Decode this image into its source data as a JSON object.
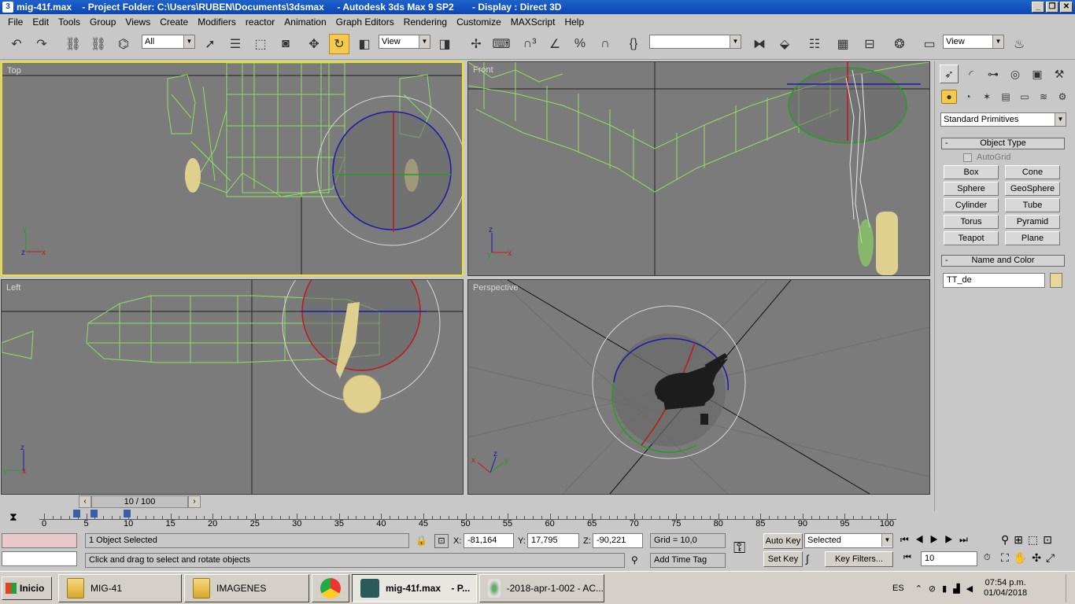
{
  "window": {
    "title": "mig-41f.max    - Project Folder: C:\\Users\\RUBEN\\Documents\\3dsmax     - Autodesk 3ds Max 9 SP2       - Display : Direct 3D",
    "app_icon": "3ds-max-icon",
    "buttons": [
      "_",
      "❐",
      "✕"
    ]
  },
  "menu": [
    "File",
    "Edit",
    "Tools",
    "Group",
    "Views",
    "Create",
    "Modifiers",
    "reactor",
    "Animation",
    "Graph Editors",
    "Rendering",
    "Customize",
    "MAXScript",
    "Help"
  ],
  "toolbar": {
    "selection_filter": "All",
    "ref_coord": "View",
    "named_selection": "",
    "render_view": "View"
  },
  "viewports": {
    "top": "Top",
    "front": "Front",
    "left": "Left",
    "perspective": "Perspective"
  },
  "axis": {
    "x": "x",
    "y": "y",
    "z": "z"
  },
  "command_panel": {
    "category": "Standard Primitives",
    "object_type_title": "Object Type",
    "autogrid": "AutoGrid",
    "buttons": [
      "Box",
      "Cone",
      "Sphere",
      "GeoSphere",
      "Cylinder",
      "Tube",
      "Torus",
      "Pyramid",
      "Teapot",
      "Plane"
    ],
    "name_color_title": "Name and Color",
    "object_name": "TT_de",
    "object_color": "#e8d898"
  },
  "time": {
    "frame": "10 / 100",
    "ticks": [
      "0",
      "5",
      "10",
      "15",
      "20",
      "25",
      "30",
      "35",
      "40",
      "45",
      "50",
      "55",
      "60",
      "65",
      "70",
      "75",
      "80",
      "85",
      "90",
      "95",
      "100"
    ]
  },
  "status": {
    "selected": "1 Object Selected",
    "prompt": "Click and drag to select and rotate objects",
    "x_label": "X:",
    "x": "-81,164",
    "y_label": "Y:",
    "y": "17,795",
    "z_label": "Z:",
    "z": "-90,221",
    "grid": "Grid = 10,0",
    "add_time_tag": "Add Time Tag",
    "auto_key": "Auto Key",
    "set_key": "Set Key",
    "key_mode": "Selected",
    "key_filters": "Key Filters...",
    "current_frame": "10"
  },
  "taskbar": {
    "start": "Inicio",
    "tasks": [
      "MIG-41",
      "IMAGENES",
      "",
      "mig-41f.max    - P...",
      "-2018-apr-1-002 - AC..."
    ],
    "lang": "ES",
    "time": "07:54 p.m.",
    "date": "01/04/2018"
  },
  "colors": {
    "viewport_bg": "#7b7b7b",
    "wireframe": "#8fe060",
    "active_border": "#f0e020",
    "gizmo_blue": "#1a1aa8",
    "gizmo_red": "#c01818",
    "gizmo_green": "#20a020",
    "highlight": "#f5c94b"
  }
}
